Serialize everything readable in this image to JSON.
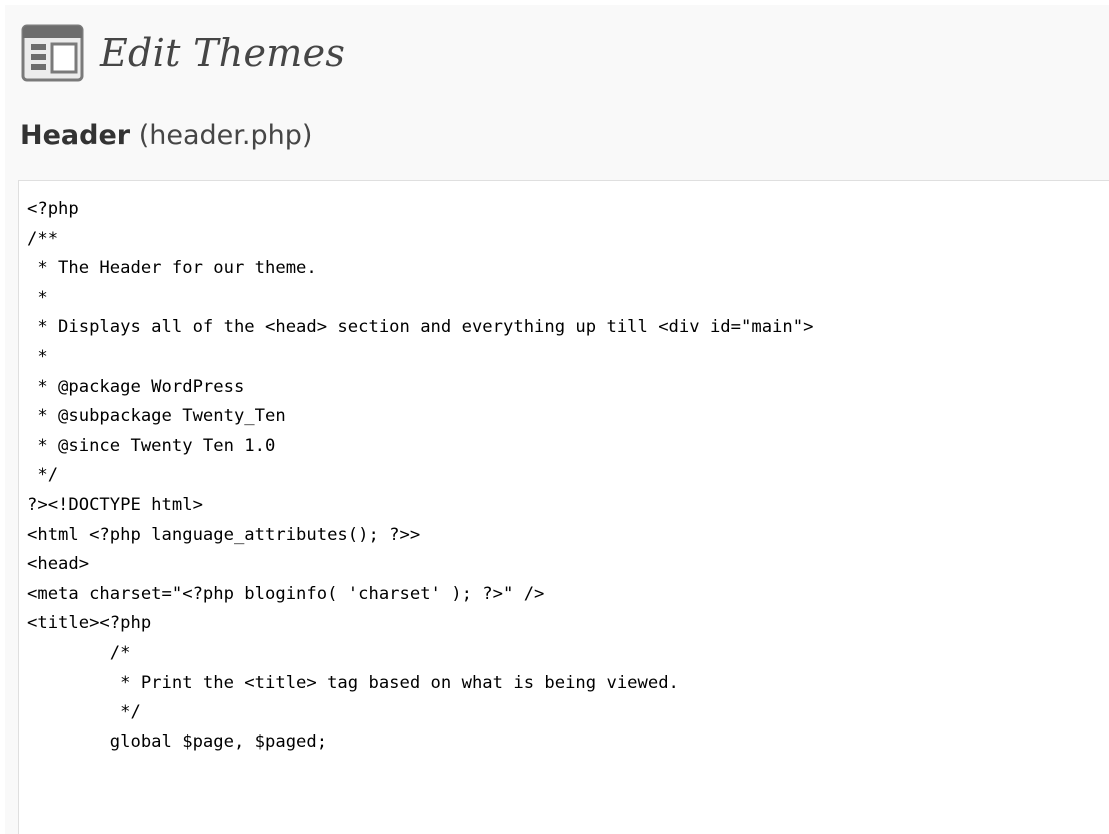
{
  "page": {
    "title": "Edit Themes",
    "icon": "appearance-icon"
  },
  "file": {
    "name": "Header",
    "filename": "(header.php)"
  },
  "editor": {
    "lines": [
      "<?php",
      "/**",
      " * The Header for our theme.",
      " *",
      " * Displays all of the <head> section and everything up till <div id=\"main\">",
      " *",
      " * @package WordPress",
      " * @subpackage Twenty_Ten",
      " * @since Twenty Ten 1.0",
      " */",
      "?><!DOCTYPE html>",
      "<html <?php language_attributes(); ?>>",
      "<head>",
      "<meta charset=\"<?php bloginfo( 'charset' ); ?>\" />",
      "<title><?php",
      "        /*",
      "         * Print the <title> tag based on what is being viewed.",
      "         */",
      "        global $page, $paged;"
    ]
  },
  "colors": {
    "background": "#f9f9f9",
    "title": "#464646",
    "editor_border": "#dfdfdf",
    "icon_gray": "#6d6d6d",
    "icon_light": "#ececec"
  }
}
